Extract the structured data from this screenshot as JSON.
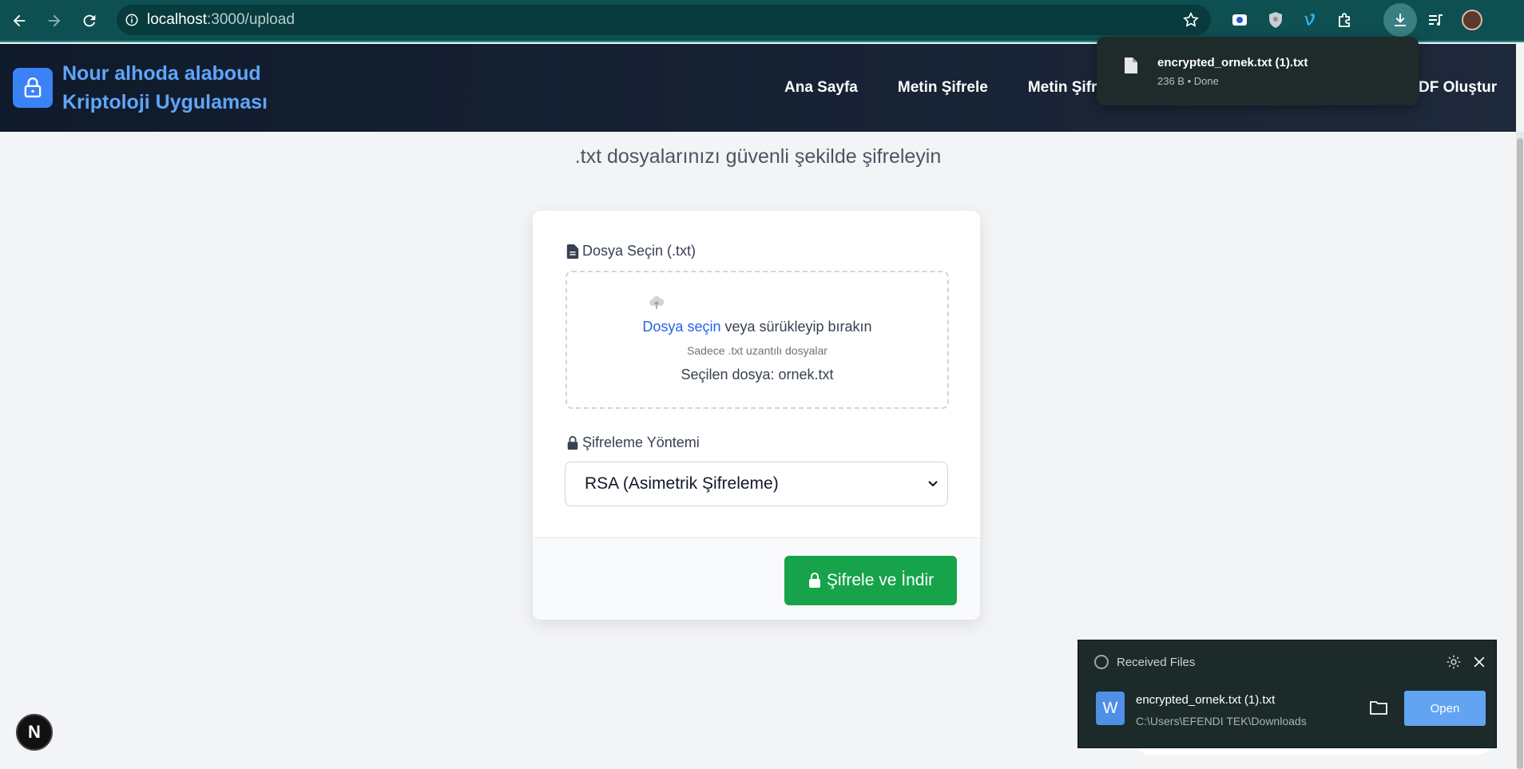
{
  "browser": {
    "url_host": "localhost",
    "url_path": ":3000/upload"
  },
  "header": {
    "brand_line1": "Nour alhoda alaboud",
    "brand_line2": "Kriptoloji Uygulaması",
    "menu": [
      "Ana Sayfa",
      "Metin Şifrele",
      "Metin Şifre Çö",
      "DF Oluştur"
    ]
  },
  "main": {
    "subtitle": ".txt dosyalarınızı güvenli şekilde şifreleyin",
    "file_label": "Dosya Seçin (.txt)",
    "dropzone": {
      "link": "Dosya seçin",
      "rest": " veya sürükleyip bırakın",
      "hint": "Sadece .txt uzantılı dosyalar",
      "selected": "Seçilen dosya: ornek.txt"
    },
    "method_label": "Şifreleme Yöntemi",
    "method_value": "RSA (Asimetrik Şifreleme)",
    "submit_label": "Şifrele ve İndir"
  },
  "download_bubble": {
    "filename": "encrypted_ornek.txt (1).txt",
    "meta": "236 B • Done"
  },
  "toast": {
    "title": "Received Files",
    "filename": "encrypted_ornek.txt (1).txt",
    "path": "C:\\Users\\EFENDI TEK\\Downloads",
    "open_label": "Open"
  },
  "next_badge": "N",
  "colors": {
    "chrome": "#0e4f52",
    "accent_blue": "#2563eb",
    "submit_green": "#16a34a",
    "header_bg": "#0f1a2b"
  }
}
